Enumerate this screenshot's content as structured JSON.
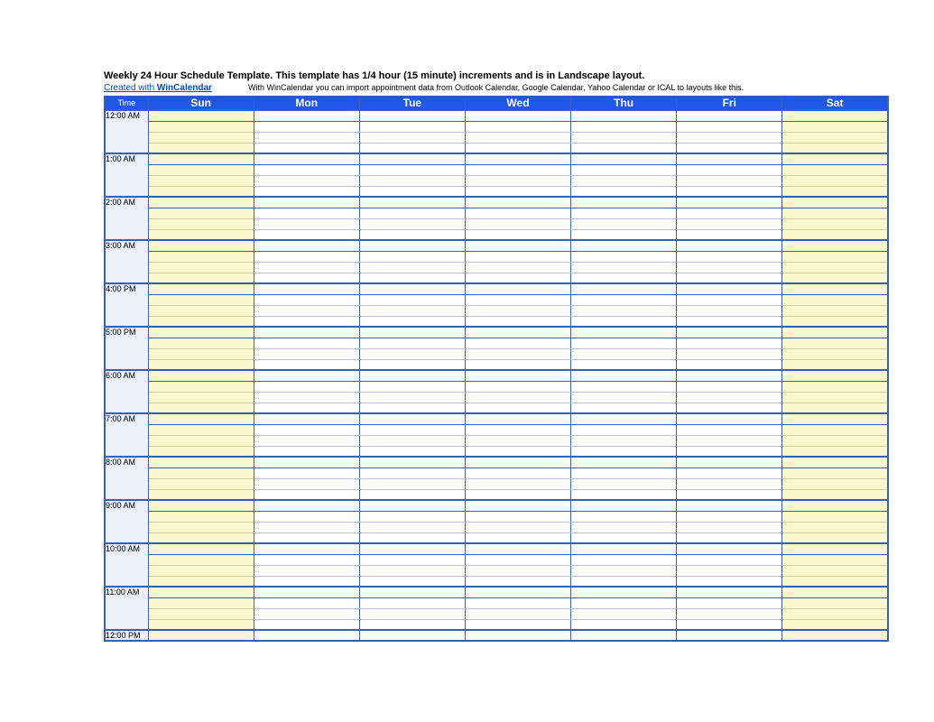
{
  "title": "Weekly 24 Hour Schedule Template.  This template has 1/4 hour (15 minute) increments and is in Landscape layout.",
  "created_with_prefix": "Created with ",
  "created_with_brand": "WinCalendar",
  "import_note": "With WinCalendar you can import appointment data from Outlook Calendar, Google Calendar, Yahoo Calendar or ICAL to layouts like this.",
  "header": {
    "time": "Time",
    "days": [
      "Sun",
      "Mon",
      "Tue",
      "Wed",
      "Thu",
      "Fri",
      "Sat"
    ]
  },
  "hours": [
    "12:00 AM",
    "1:00 AM",
    "2:00 AM",
    "3:00 AM",
    "4:00 PM",
    "5:00 PM",
    "6:00 AM",
    "7:00 AM",
    "8:00 AM",
    "9:00 AM",
    "10:00 AM",
    "11:00 AM",
    "12:00 PM"
  ],
  "weekend_indexes": [
    0,
    6
  ],
  "slots_per_hour": 4
}
